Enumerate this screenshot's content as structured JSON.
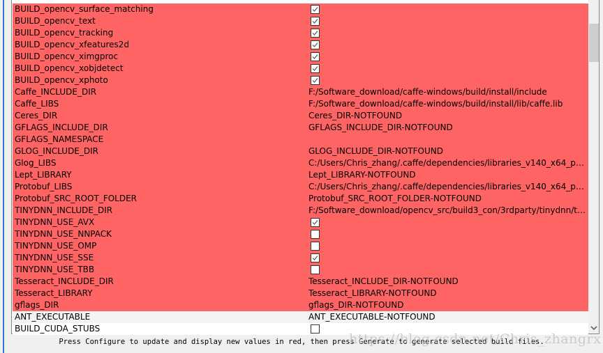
{
  "rows": [
    {
      "name": "BUILD_opencv_surface_matching",
      "type": "bool",
      "checked": true,
      "state": "new"
    },
    {
      "name": "BUILD_opencv_text",
      "type": "bool",
      "checked": true,
      "state": "new"
    },
    {
      "name": "BUILD_opencv_tracking",
      "type": "bool",
      "checked": true,
      "state": "new"
    },
    {
      "name": "BUILD_opencv_xfeatures2d",
      "type": "bool",
      "checked": true,
      "state": "new"
    },
    {
      "name": "BUILD_opencv_ximgproc",
      "type": "bool",
      "checked": true,
      "state": "new"
    },
    {
      "name": "BUILD_opencv_xobjdetect",
      "type": "bool",
      "checked": true,
      "state": "new"
    },
    {
      "name": "BUILD_opencv_xphoto",
      "type": "bool",
      "checked": true,
      "state": "new"
    },
    {
      "name": "Caffe_INCLUDE_DIR",
      "type": "text",
      "value": "F:/Software_download/caffe-windows/build/install/include",
      "state": "new"
    },
    {
      "name": "Caffe_LIBS",
      "type": "text",
      "value": "F:/Software_download/caffe-windows/build/install/lib/caffe.lib",
      "state": "new"
    },
    {
      "name": "Ceres_DIR",
      "type": "text",
      "value": "Ceres_DIR-NOTFOUND",
      "state": "new"
    },
    {
      "name": "GFLAGS_INCLUDE_DIR",
      "type": "text",
      "value": "GFLAGS_INCLUDE_DIR-NOTFOUND",
      "state": "new"
    },
    {
      "name": "GFLAGS_NAMESPACE",
      "type": "text",
      "value": "",
      "state": "new"
    },
    {
      "name": "GLOG_INCLUDE_DIR",
      "type": "text",
      "value": "GLOG_INCLUDE_DIR-NOTFOUND",
      "state": "new"
    },
    {
      "name": "Glog_LIBS",
      "type": "text",
      "value": "C:/Users/Chris_zhang/.caffe/dependencies/libraries_v140_x64_py35...",
      "state": "new"
    },
    {
      "name": "Lept_LIBRARY",
      "type": "text",
      "value": "Lept_LIBRARY-NOTFOUND",
      "state": "new"
    },
    {
      "name": "Protobuf_LIBS",
      "type": "text",
      "value": "C:/Users/Chris_zhang/.caffe/dependencies/libraries_v140_x64_py35...",
      "state": "new"
    },
    {
      "name": "Protobuf_SRC_ROOT_FOLDER",
      "type": "text",
      "value": "Protobuf_SRC_ROOT_FOLDER-NOTFOUND",
      "state": "new"
    },
    {
      "name": "TINYDNN_INCLUDE_DIR",
      "type": "text",
      "value": "F:/Software_download/opencv_src/build3_con/3rdparty/tinydnn/tin...",
      "state": "new"
    },
    {
      "name": "TINYDNN_USE_AVX",
      "type": "bool",
      "checked": true,
      "state": "new"
    },
    {
      "name": "TINYDNN_USE_NNPACK",
      "type": "bool",
      "checked": false,
      "state": "new"
    },
    {
      "name": "TINYDNN_USE_OMP",
      "type": "bool",
      "checked": false,
      "state": "new"
    },
    {
      "name": "TINYDNN_USE_SSE",
      "type": "bool",
      "checked": true,
      "state": "new"
    },
    {
      "name": "TINYDNN_USE_TBB",
      "type": "bool",
      "checked": false,
      "state": "new"
    },
    {
      "name": "Tesseract_INCLUDE_DIR",
      "type": "text",
      "value": "Tesseract_INCLUDE_DIR-NOTFOUND",
      "state": "new"
    },
    {
      "name": "Tesseract_LIBRARY",
      "type": "text",
      "value": "Tesseract_LIBRARY-NOTFOUND",
      "state": "new"
    },
    {
      "name": "gflags_DIR",
      "type": "text",
      "value": "gflags_DIR-NOTFOUND",
      "state": "new"
    },
    {
      "name": "ANT_EXECUTABLE",
      "type": "text",
      "value": "ANT_EXECUTABLE-NOTFOUND",
      "state": "alt"
    },
    {
      "name": "BUILD_CUDA_STUBS",
      "type": "bool",
      "checked": false,
      "state": "normal"
    }
  ],
  "colors": {
    "new_row": "#ff6464",
    "normal_row": "#ffffff",
    "alt_row": "#f3f3f3"
  },
  "scrollbar": {
    "position_fraction": 0.08
  },
  "status": {
    "text": "Press Configure to update and display new values in red, then press Generate to generate selected build files."
  },
  "watermark": {
    "text": "https://blog.csdn.net/Chris_zhangrx"
  }
}
